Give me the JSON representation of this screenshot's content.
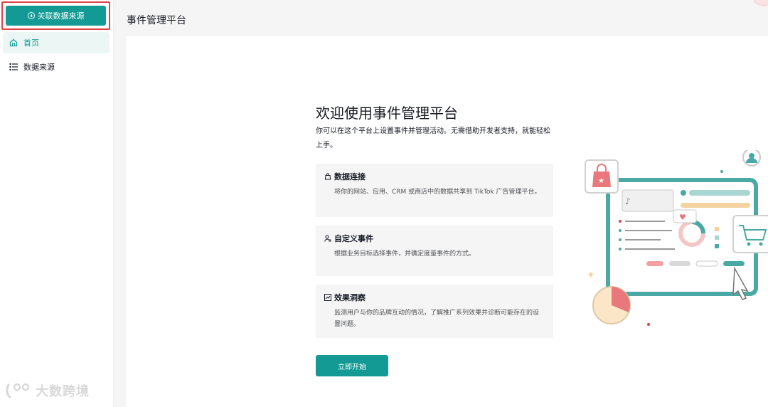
{
  "sidebar": {
    "connect_button": "关联数据来源",
    "items": [
      {
        "label": "首页",
        "icon": "home-icon",
        "active": true
      },
      {
        "label": "数据来源",
        "icon": "list-icon",
        "active": false
      }
    ]
  },
  "header": {
    "title": "事件管理平台"
  },
  "main": {
    "title": "欢迎使用事件管理平台",
    "description": "你可以在这个平台上设置事件并管理活动。无需借助开发者支持，就能轻松上手。",
    "cards": [
      {
        "title": "数据连接",
        "icon": "shopping-bag-icon",
        "body": "将你的网站、应用、CRM 或商店中的数据共享到 TikTok 广告管理平台。"
      },
      {
        "title": "自定义事件",
        "icon": "user-settings-icon",
        "body": "根据业务目标选择事件，并确定度量事件的方式。"
      },
      {
        "title": "效果洞察",
        "icon": "trend-chart-icon",
        "body": "监测用户与你的品牌互动的情况，了解推广系列效果并诊断可能存在的设置问题。"
      }
    ],
    "start_button": "立即开始"
  },
  "watermark": {
    "text": "大数跨境"
  },
  "colors": {
    "accent": "#139a94",
    "highlight_border": "#e0414c",
    "card_bg": "#f5f5f5"
  }
}
